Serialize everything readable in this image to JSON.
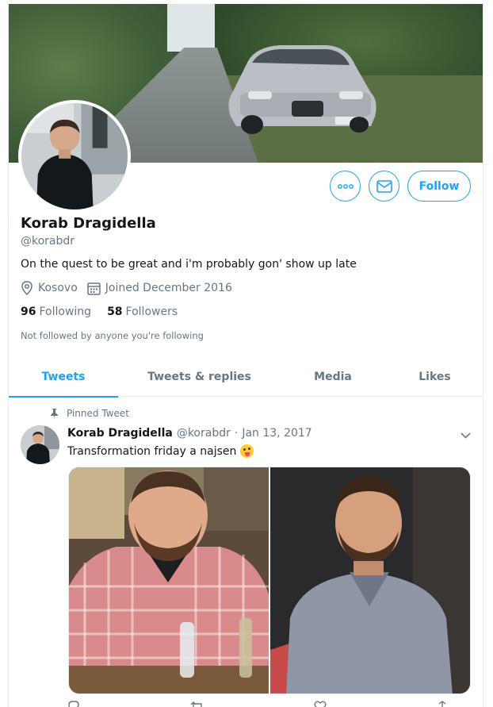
{
  "profile": {
    "name": "Korab Dragidella",
    "handle": "@korabdr",
    "bio": "On the quest to be great and i'm probably gon' show up late",
    "location": "Kosovo",
    "joined": "Joined December 2016",
    "following_count": "96",
    "following_label": "Following",
    "followers_count": "58",
    "followers_label": "Followers",
    "not_followed": "Not followed by anyone you're following"
  },
  "actions": {
    "follow_label": "Follow",
    "more_icon": "more-icon",
    "message_icon": "envelope-icon"
  },
  "tabs": [
    {
      "label": "Tweets",
      "active": true
    },
    {
      "label": "Tweets & replies",
      "active": false
    },
    {
      "label": "Media",
      "active": false
    },
    {
      "label": "Likes",
      "active": false
    }
  ],
  "tweet": {
    "pinned_label": "Pinned Tweet",
    "author": "Korab Dragidella",
    "handle": "@korabdr",
    "separator": "·",
    "date": "Jan 13, 2017",
    "text": "Transformation friday a najsen",
    "emoji": "winking-tongue-face"
  },
  "colors": {
    "accent": "#1da1f2",
    "secondary_text": "#657786",
    "primary_text": "#14171a",
    "border": "#e6ecf0"
  }
}
